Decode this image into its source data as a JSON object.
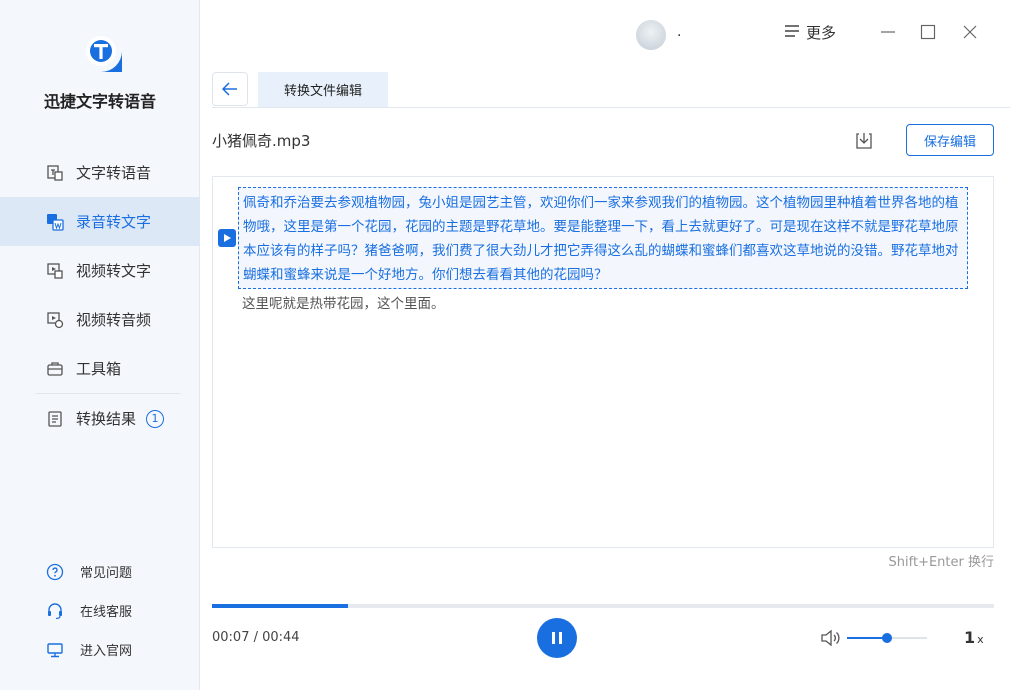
{
  "app": {
    "title": "迅捷文字转语音",
    "accent": "#1a6fe0",
    "logo_text": "T"
  },
  "sidebar": {
    "items": [
      {
        "label": "文字转语音",
        "icon": "text-to-speech-icon",
        "active": false
      },
      {
        "label": "录音转文字",
        "icon": "audio-to-text-icon",
        "active": true
      },
      {
        "label": "视频转文字",
        "icon": "video-to-text-icon",
        "active": false
      },
      {
        "label": "视频转音频",
        "icon": "video-to-audio-icon",
        "active": false
      },
      {
        "label": "工具箱",
        "icon": "toolbox-icon",
        "active": false
      }
    ],
    "results": {
      "label": "转换结果",
      "count": "1"
    },
    "bottom": [
      {
        "label": "常见问题",
        "icon": "help-icon"
      },
      {
        "label": "在线客服",
        "icon": "headset-icon"
      },
      {
        "label": "进入官网",
        "icon": "monitor-icon"
      }
    ]
  },
  "header": {
    "user_name": ".",
    "more_label": "更多"
  },
  "tabs": {
    "active_label": "转换文件编辑"
  },
  "file": {
    "name": "小猪佩奇.mp3",
    "save_label": "保存编辑"
  },
  "editor": {
    "active_paragraph": "佩奇和乔治要去参观植物园，兔小姐是园艺主管，欢迎你们一家来参观我们的植物园。这个植物园里种植着世界各地的植物哦，这里是第一个花园，花园的主题是野花草地。要是能整理一下，看上去就更好了。可是现在这样不就是野花草地原本应该有的样子吗？猪爸爸啊，我们费了很大劲儿才把它弄得这么乱的蝴蝶和蜜蜂们都喜欢这草地说的没错。野花草地对蝴蝶和蜜蜂来说是一个好地方。你们想去看看其他的花园吗？",
    "next_paragraph": "这里呢就是热带花园，这个里面。",
    "hint": "Shift+Enter 换行"
  },
  "player": {
    "time": "00:07 / 00:44",
    "progress_fraction": 0.174,
    "volume_fraction": 0.5,
    "speed_value": "1",
    "speed_unit": "x"
  }
}
